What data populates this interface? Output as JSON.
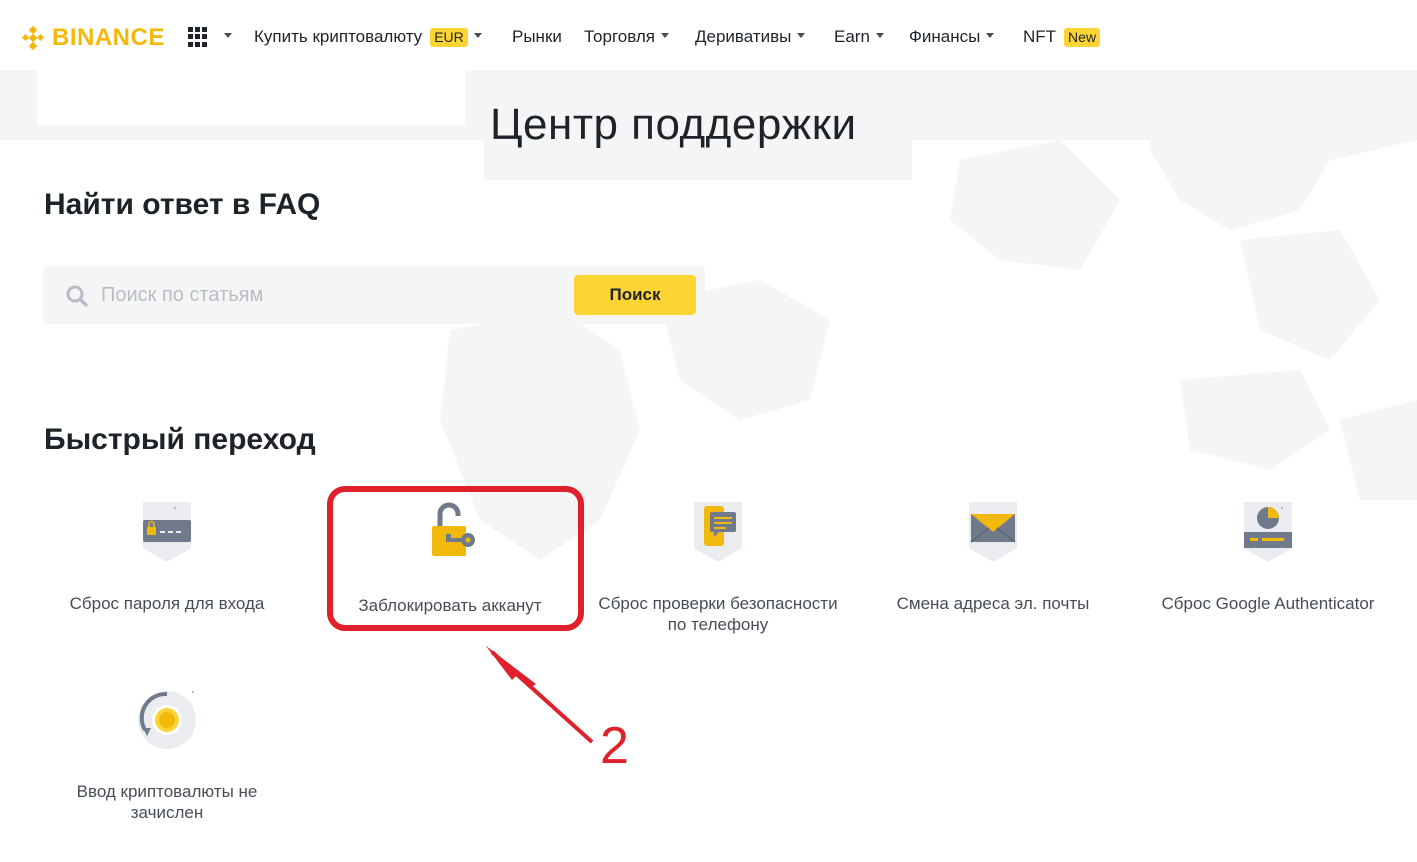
{
  "brand": {
    "name": "BINANCE",
    "color": "#f0b90b"
  },
  "nav": {
    "items": [
      {
        "label": "Купить криптовалюту",
        "badge": "EUR",
        "dropdown": true
      },
      {
        "label": "Рынки",
        "dropdown": false
      },
      {
        "label": "Торговля",
        "dropdown": true
      },
      {
        "label": "Деривативы",
        "dropdown": true
      },
      {
        "label": "Earn",
        "dropdown": true
      },
      {
        "label": "Финансы",
        "dropdown": true
      },
      {
        "label": "NFT",
        "badge": "New",
        "dropdown": false
      }
    ]
  },
  "page": {
    "title": "Центр поддержки"
  },
  "faq": {
    "heading": "Найти ответ в FAQ",
    "search_placeholder": "Поиск по статьям",
    "search_button": "Поиск"
  },
  "quick": {
    "heading": "Быстрый переход",
    "tiles": [
      {
        "label": "Сброс пароля для входа",
        "icon": "card-lock-icon"
      },
      {
        "label": "Заблокировать акканут",
        "icon": "padlock-key-icon"
      },
      {
        "label": "Сброс проверки безопасности по телефону",
        "icon": "phone-message-icon"
      },
      {
        "label": "Смена адреса эл. почты",
        "icon": "envelope-icon"
      },
      {
        "label": "Сброс Google Authenticator",
        "icon": "authenticator-icon"
      },
      {
        "label": "Ввод криптовалюты не зачислен",
        "icon": "deposit-coin-icon"
      }
    ]
  },
  "annotation": {
    "number": "2",
    "color": "#e0202b"
  },
  "colors": {
    "accent": "#fcd535",
    "text": "#1e2329",
    "muted": "#474d57"
  }
}
